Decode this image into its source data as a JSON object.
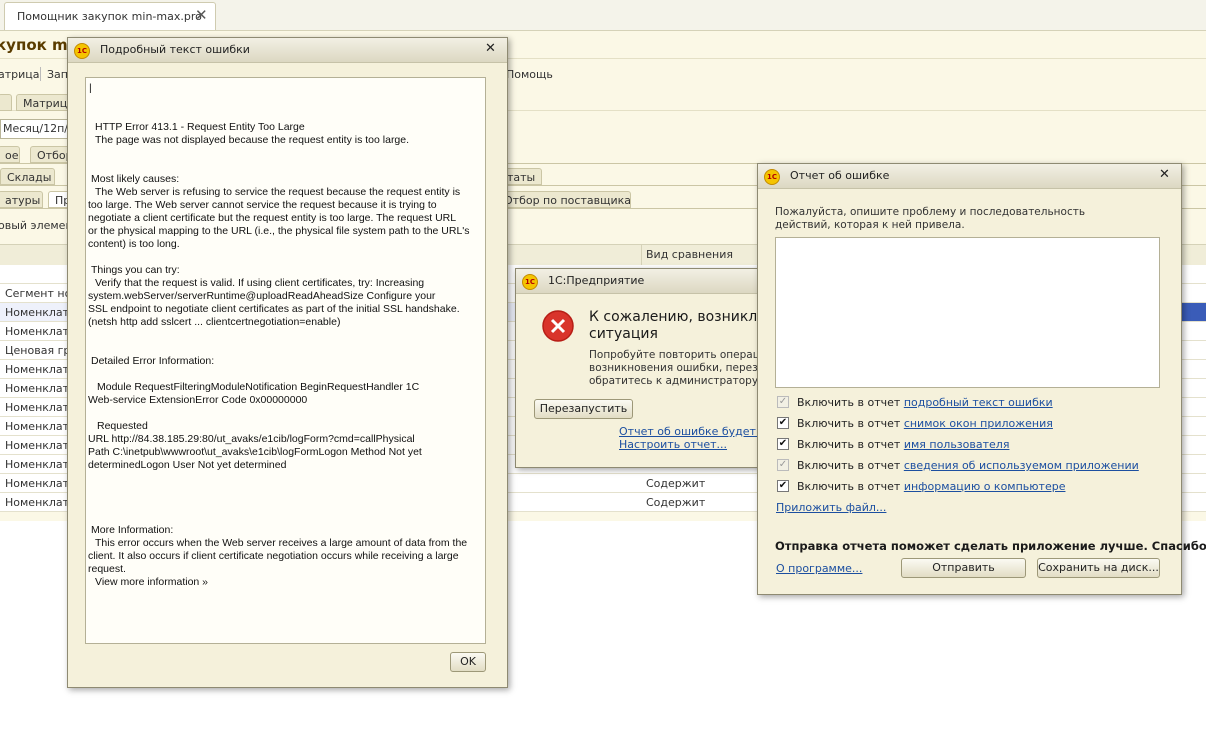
{
  "app_tab": {
    "title": "Помощник закупок min-max.pro",
    "close": "✕"
  },
  "background": {
    "title": "купок min",
    "commands": [
      "атрица",
      "Запи",
      "Помощь"
    ],
    "tabs_row1": [
      "",
      "Матрица"
    ],
    "period_field": "Месяц/12п/п",
    "tabs_row2": [
      "ое",
      "Отбор"
    ],
    "tabs_row3": [
      "Склады",
      "таты"
    ],
    "tabs_row4": [
      "атуры",
      "Пр",
      "Отбор по поставщикам"
    ],
    "new_element": "овый элемент",
    "grid_header_compare": "Вид сравнения",
    "rows": [
      {
        "name": "Сегмент ном",
        "compare": ""
      },
      {
        "name": "Номенклату",
        "compare": ""
      },
      {
        "name": "Номенклату",
        "compare": ""
      },
      {
        "name": "Ценовая гру",
        "compare": ""
      },
      {
        "name": "Номенклату",
        "compare": ""
      },
      {
        "name": "Номенклату",
        "compare": ""
      },
      {
        "name": "Номенклату",
        "compare": ""
      },
      {
        "name": "Номенклату",
        "compare": ""
      },
      {
        "name": "Номенклату",
        "compare": ""
      },
      {
        "name": "Номенклату",
        "compare": ""
      },
      {
        "name": "Номенклату",
        "compare": "Содержит"
      },
      {
        "name": "Номенклату",
        "compare": "Содержит"
      }
    ]
  },
  "detail_dialog": {
    "title": "Подробный текст ошибки",
    "logo": "1С",
    "close": "✕",
    "cursor": "|",
    "lines": [
      "HTTP Error 413.1 - Request Entity Too Large",
      "The page was not displayed because the request entity is too large.",
      "Most likely causes:",
      "The Web server is refusing to service the request because the request entity is",
      "too large.  The Web server cannot service the request because it is trying to",
      "negotiate a client certificate but the request entity is too large.    The request URL",
      "or the physical mapping to the URL (i.e., the physical file system path to the URL's",
      "content) is too long.",
      "Things you can try:",
      "Verify that the request is valid.   If using client certificates, try:          Increasing",
      "system.webServer/serverRuntime@uploadReadAheadSize          Configure your",
      "SSL endpoint to negotiate client certificates as part of the initial SSL handshake.",
      "(netsh http add sslcert ... clientcertnegotiation=enable)",
      "Detailed Error Information:",
      "Module   RequestFilteringModuleNotification   BeginRequestHandler   1C",
      "Web-service ExtensionError Code    0x00000000",
      "Requested",
      "URL    http://84.38.185.29:80/ut_avaks/e1cib/logForm?cmd=callPhysical",
      "Path    C:\\inetpub\\wwwroot\\ut_avaks\\e1cib\\logFormLogon Method    Not yet",
      "determinedLogon User    Not yet determined",
      "More Information:",
      "This error occurs when the Web server receives a large amount of data from the",
      "client. It also occurs if client certificate negotiation occurs while receiving a large",
      "request.",
      "View more information »"
    ],
    "ok": "OK"
  },
  "enterprise_dialog": {
    "title": "1С:Предприятие",
    "logo": "1С",
    "heading_line1": "К сожалению, возникла не",
    "heading_line2": "ситуация",
    "text_line1": "Попробуйте повторить операцию",
    "text_line2": "возникновения ошибки, перезапу",
    "text_line3": "обратитесь к администратору.",
    "restart": "Перезапустить",
    "report_link": "Отчет об ошибке будет отпр",
    "configure_link": "Настроить отчет..."
  },
  "report_dialog": {
    "title": "Отчет об ошибке",
    "logo": "1С",
    "close": "✕",
    "prompt_line1": "Пожалуйста, опишите проблему и последовательность",
    "prompt_line2": "действий, которая к ней привела.",
    "include_prefix": "Включить в отчет",
    "options": [
      {
        "link": "подробный текст ошибки",
        "checked": true,
        "disabled": true
      },
      {
        "link": "снимок окон приложения",
        "checked": true,
        "disabled": false
      },
      {
        "link": "имя пользователя",
        "checked": true,
        "disabled": false
      },
      {
        "link": "сведения об используемом приложении",
        "checked": true,
        "disabled": true
      },
      {
        "link": "информацию о компьютере",
        "checked": true,
        "disabled": false
      }
    ],
    "attach": "Приложить файл...",
    "thanks": "Отправка отчета поможет сделать приложение лучше. Спасибо!",
    "about": "О программе...",
    "send": "Отправить",
    "save": "Сохранить на диск..."
  },
  "colors": {
    "accent": "#3a5cb8",
    "link": "#1c4fa0",
    "dialog_bg": "#f5f1db",
    "error_red": "#d9342b"
  }
}
